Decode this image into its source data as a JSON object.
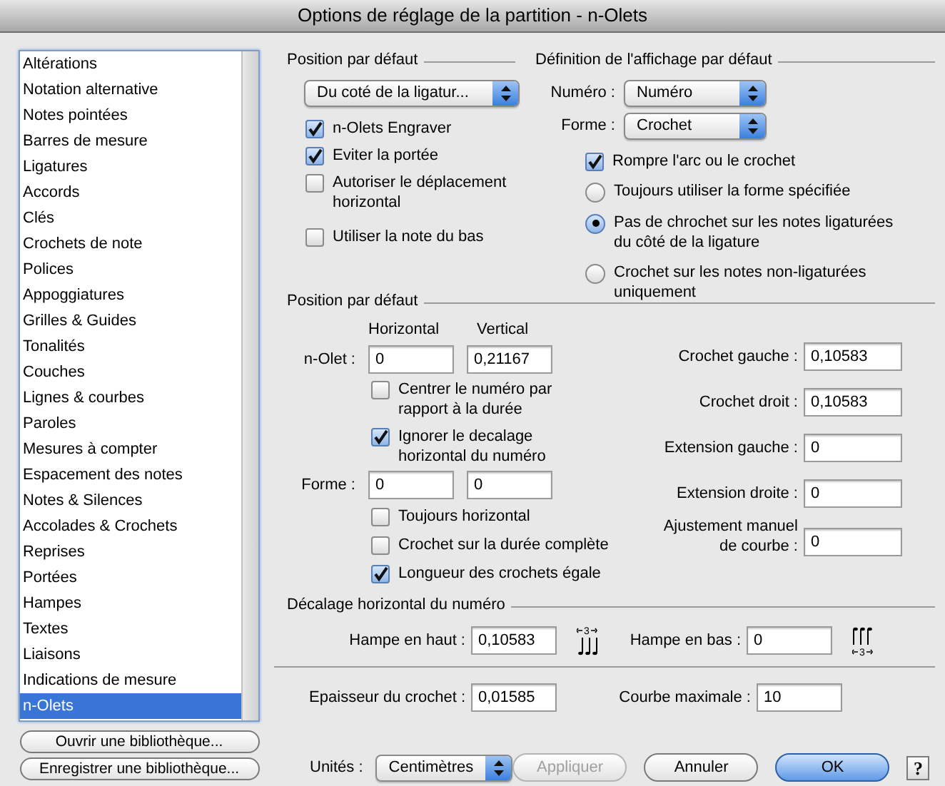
{
  "window": {
    "title": "Options de réglage de la partition - n-Olets"
  },
  "sidebar": {
    "items": [
      {
        "label": "Altérations",
        "selected": false
      },
      {
        "label": "Notation alternative",
        "selected": false
      },
      {
        "label": "Notes pointées",
        "selected": false
      },
      {
        "label": "Barres de mesure",
        "selected": false
      },
      {
        "label": "Ligatures",
        "selected": false
      },
      {
        "label": "Accords",
        "selected": false
      },
      {
        "label": "Clés",
        "selected": false
      },
      {
        "label": "Crochets de note",
        "selected": false
      },
      {
        "label": "Polices",
        "selected": false
      },
      {
        "label": "Appoggiatures",
        "selected": false
      },
      {
        "label": "Grilles & Guides",
        "selected": false
      },
      {
        "label": "Tonalités",
        "selected": false
      },
      {
        "label": "Couches",
        "selected": false
      },
      {
        "label": "Lignes & courbes",
        "selected": false
      },
      {
        "label": "Paroles",
        "selected": false
      },
      {
        "label": "Mesures à compter",
        "selected": false
      },
      {
        "label": "Espacement des notes",
        "selected": false
      },
      {
        "label": "Notes & Silences",
        "selected": false
      },
      {
        "label": "Accolades & Crochets",
        "selected": false
      },
      {
        "label": "Reprises",
        "selected": false
      },
      {
        "label": "Portées",
        "selected": false
      },
      {
        "label": "Hampes",
        "selected": false
      },
      {
        "label": "Textes",
        "selected": false
      },
      {
        "label": "Liaisons",
        "selected": false
      },
      {
        "label": "Indications de mesure",
        "selected": false
      },
      {
        "label": "n-Olets",
        "selected": true
      }
    ],
    "buttons": [
      "Ouvrir une bibliothèque...",
      "Enregistrer une bibliothèque..."
    ]
  },
  "default_position": {
    "title": "Position par défaut",
    "dropdown": {
      "value": "Du coté de la ligatur..."
    },
    "checkboxes": [
      {
        "label": "n-Olets Engraver",
        "checked": true
      },
      {
        "label": "Eviter la portée",
        "checked": true
      },
      {
        "label": "Autoriser le déplacement\nhorizontal",
        "checked": false
      },
      {
        "label": "Utiliser la note du bas",
        "checked": false
      }
    ]
  },
  "display_definition": {
    "title": "Définition de l'affichage par défaut",
    "number": {
      "label": "Numéro :",
      "value": "Numéro"
    },
    "shape": {
      "label": "Forme :",
      "value": "Crochet"
    },
    "break_checkbox": {
      "label": "Rompre l'arc ou le crochet",
      "checked": true
    },
    "radios": [
      {
        "label": "Toujours utiliser la forme spécifiée",
        "selected": false
      },
      {
        "label": "Pas de chrochet sur les notes ligaturées\ndu côté de la ligature",
        "selected": true
      },
      {
        "label": "Crochet sur les notes non-ligaturées\nuniquement",
        "selected": false
      }
    ]
  },
  "position": {
    "title": "Position par défaut",
    "columns": [
      "Horizontal",
      "Vertical"
    ],
    "tuplet": {
      "label": "n-Olet :",
      "horizontal": "0",
      "vertical": "0,21167"
    },
    "tuplet_checkboxes": [
      {
        "label": "Centrer le numéro par\nrapport à la durée",
        "checked": false
      },
      {
        "label": "Ignorer le decalage\nhorizontal du numéro",
        "checked": true
      }
    ],
    "shape": {
      "label": "Forme :",
      "horizontal": "0",
      "vertical": "0"
    },
    "shape_checkboxes": [
      {
        "label": "Toujours horizontal",
        "checked": false
      },
      {
        "label": "Crochet sur la durée complète",
        "checked": false
      },
      {
        "label": "Longueur des crochets égale",
        "checked": true
      }
    ],
    "right_fields": [
      {
        "label": "Crochet gauche :",
        "value": "0,10583"
      },
      {
        "label": "Crochet droit :",
        "value": "0,10583"
      },
      {
        "label": "Extension gauche :",
        "value": "0"
      },
      {
        "label": "Extension droite :",
        "value": "0"
      },
      {
        "label": "Ajustement manuel\nde courbe :",
        "value": "0"
      }
    ]
  },
  "number_offset": {
    "title": "Décalage horizontal du numéro",
    "stem_up": {
      "label": "Hampe en haut :",
      "value": "0,10583",
      "icon_number": "3"
    },
    "stem_down": {
      "label": "Hampe en bas :",
      "value": "0",
      "icon_number": "3"
    }
  },
  "bracket_thickness": {
    "label": "Epaisseur du crochet :",
    "value": "0,01585"
  },
  "max_curve": {
    "label": "Courbe maximale :",
    "value": "10"
  },
  "footer": {
    "units": {
      "label": "Unités :",
      "value": "Centimètres"
    },
    "buttons": [
      {
        "label": "Appliquer",
        "kind": "normal",
        "disabled": true
      },
      {
        "label": "Annuler",
        "kind": "normal",
        "disabled": false
      },
      {
        "label": "OK",
        "kind": "default",
        "disabled": false
      }
    ],
    "help": "?"
  }
}
